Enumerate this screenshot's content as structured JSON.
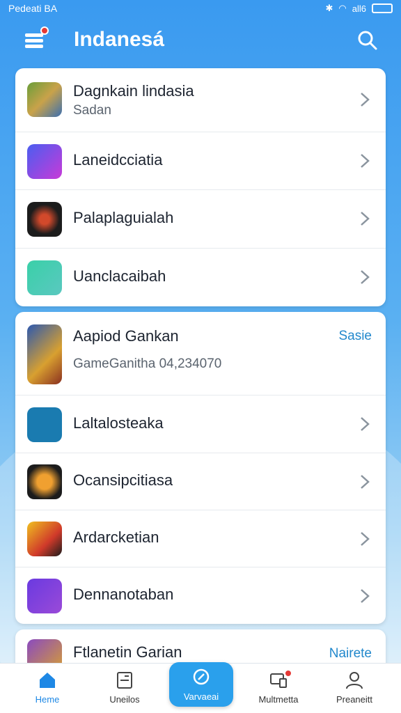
{
  "status": {
    "left": "Pedeati BA",
    "right": "all6"
  },
  "header": {
    "title": "Indanesá"
  },
  "card1": {
    "items": [
      {
        "name": "Dagnkain lindasia",
        "sub": "Sadan"
      },
      {
        "name": "Laneidcciatia"
      },
      {
        "name": "Palaplaguialah"
      },
      {
        "name": "Uanclacaibah"
      }
    ]
  },
  "card2": {
    "featured": {
      "name": "Aapiod Gankan",
      "sub": "GameGanitha 04,234070",
      "action": "Sasie"
    },
    "items": [
      {
        "name": "Laltalosteaka"
      },
      {
        "name": "Ocansipcitiasa"
      },
      {
        "name": "Ardarcketian"
      },
      {
        "name": "Dennanotaban"
      }
    ]
  },
  "card3": {
    "name": "Ftlanetin Garian",
    "action": "Nairete"
  },
  "nav": {
    "items": [
      "Heme",
      "Uneilos",
      "Varvaeai",
      "Multmetta",
      "Preaneitt"
    ]
  },
  "colors": {
    "accent": "#2aa0ec",
    "link": "#2288cc",
    "active_nav": "#1e88e5"
  }
}
